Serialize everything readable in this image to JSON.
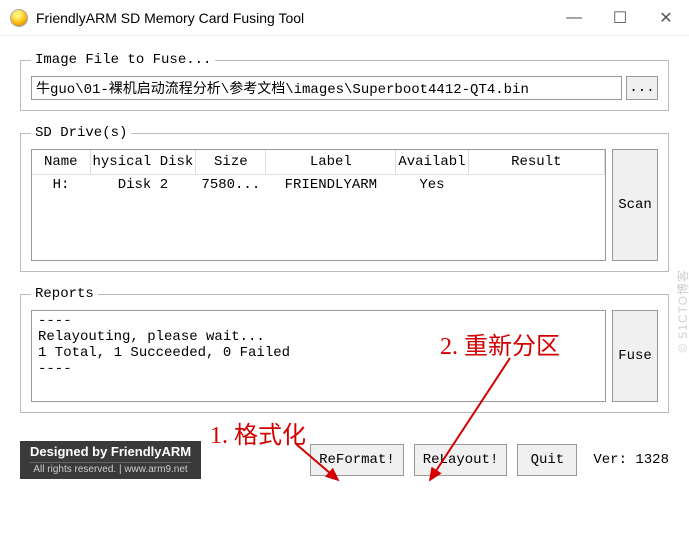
{
  "window": {
    "title": "FriendlyARM SD Memory Card Fusing Tool",
    "minimize": "—",
    "maximize": "☐",
    "close": "✕"
  },
  "image_file": {
    "legend": "Image File to Fuse...",
    "path": "牛guo\\01-裸机启动流程分析\\参考文档\\images\\Superboot4412-QT4.bin",
    "browse": "..."
  },
  "sd": {
    "legend": "SD Drive(s)",
    "scan": "Scan",
    "columns": [
      "Name",
      "hysical Disk",
      "Size",
      "Label",
      "Availabl",
      "Result"
    ],
    "rows": [
      {
        "name": "H:",
        "disk": "Disk 2",
        "size": "7580...",
        "label": "FRIENDLYARM",
        "avail": "Yes",
        "result": ""
      }
    ]
  },
  "reports": {
    "legend": "Reports",
    "text": "----\nRelayouting, please wait...\n1 Total, 1 Succeeded, 0 Failed\n----",
    "fuse": "Fuse"
  },
  "designed": {
    "line1": "Designed by FriendlyARM",
    "line2": "All rights reserved. | www.arm9.net"
  },
  "buttons": {
    "reformat": "ReFormat!",
    "relayout": "ReLayout!",
    "quit": "Quit"
  },
  "version": "Ver: 1328",
  "annotations": {
    "a1": "1. 格式化",
    "a2": "2. 重新分区"
  },
  "watermark": "© 51CTO博客"
}
